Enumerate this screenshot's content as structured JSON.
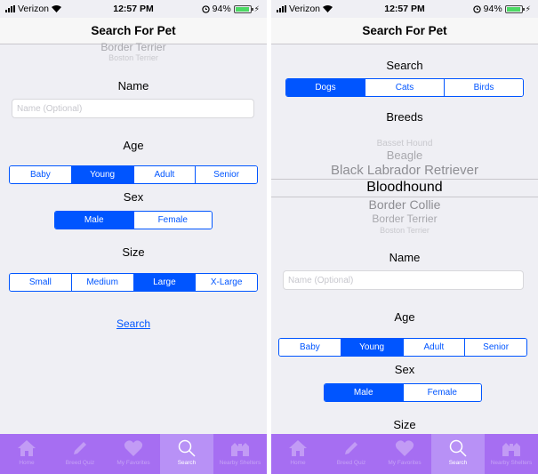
{
  "left": {
    "status": {
      "carrier": "Verizon",
      "time": "12:57 PM",
      "battery": "94%"
    },
    "nav_title": "Search For Pet",
    "breeds_picker": {
      "rows": [
        "Border Terrier",
        "Boston Terrier"
      ]
    },
    "name_label": "Name",
    "name_placeholder": "Name (Optional)",
    "age_label": "Age",
    "age_options": [
      "Baby",
      "Young",
      "Adult",
      "Senior"
    ],
    "sex_label": "Sex",
    "sex_options": [
      "Male",
      "Female"
    ],
    "size_label": "Size",
    "size_options": [
      "Small",
      "Medium",
      "Large",
      "X-Large"
    ],
    "search_link": "Search"
  },
  "right": {
    "status": {
      "carrier": "Verizon",
      "time": "12:57 PM",
      "battery": "94%"
    },
    "nav_title": "Search For Pet",
    "search_label": "Search",
    "animal_options": [
      "Dogs",
      "Cats",
      "Birds"
    ],
    "breeds_label": "Breeds",
    "breeds_picker": {
      "rows": [
        "Basset Hound",
        "Beagle",
        "Black Labrador Retriever",
        "Bloodhound",
        "Border Collie",
        "Border Terrier",
        "Boston Terrier"
      ],
      "selected": "Bloodhound"
    },
    "name_label": "Name",
    "name_placeholder": "Name (Optional)",
    "age_label": "Age",
    "age_options": [
      "Baby",
      "Young",
      "Adult",
      "Senior"
    ],
    "sex_label": "Sex",
    "sex_options": [
      "Male",
      "Female"
    ],
    "size_label": "Size"
  },
  "tabbar": {
    "items": [
      {
        "label": "Home",
        "icon": "home-icon"
      },
      {
        "label": "Breed Quiz",
        "icon": "pencil-icon"
      },
      {
        "label": "My Favorites",
        "icon": "heart-icon"
      },
      {
        "label": "Search",
        "icon": "search-icon"
      },
      {
        "label": "Nearby Shelters",
        "icon": "shelter-icon"
      }
    ],
    "active": "Search"
  },
  "colors": {
    "accent": "#0055ff",
    "tabbar_bg": "#a66ef2",
    "tabbar_active_bg": "#b891f6",
    "background": "#efeff4"
  }
}
